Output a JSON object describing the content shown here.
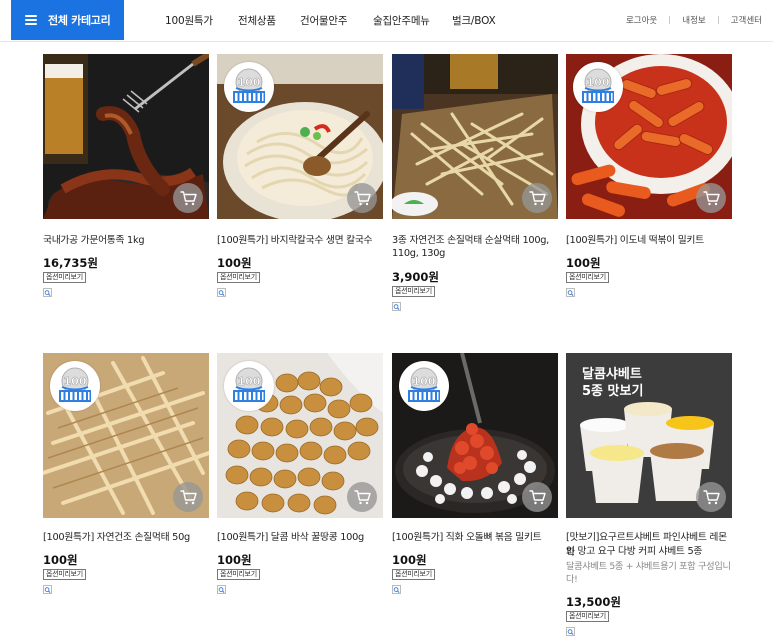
{
  "header": {
    "category_button": "전체 카테고리",
    "nav": [
      "100원특가",
      "전체상품",
      "건어물안주",
      "술집안주메뉴",
      "벌크/BOX"
    ],
    "utility": [
      "로그아웃",
      "내정보",
      "고객센터"
    ]
  },
  "products": [
    {
      "name": "국내가공 가문어통족 1kg",
      "name2": "",
      "desc": "",
      "price": "16,735원",
      "option": "옵션미리보기",
      "badge": false,
      "image": "grilled-squid"
    },
    {
      "name": "[100원특가] 바지락칼국수 생면 칼국수",
      "name2": "",
      "desc": "",
      "price": "100원",
      "option": "옵션미리보기",
      "badge": true,
      "image": "kalguksu"
    },
    {
      "name": "3종 자연건조 손질먹태 순살먹태 100g,",
      "name2": "110g, 130g",
      "desc": "",
      "price": "3,900원",
      "option": "옵션미리보기",
      "badge": false,
      "image": "dried-pollock"
    },
    {
      "name": "[100원특가] 이도네 떡볶이 밀키트",
      "name2": "",
      "desc": "",
      "price": "100원",
      "option": "옵션미리보기",
      "badge": true,
      "image": "tteokbokki"
    },
    {
      "name": "[100원특가] 자연건조 손질먹태 50g",
      "name2": "",
      "desc": "",
      "price": "100원",
      "option": "옵션미리보기",
      "badge": true,
      "image": "dried-pollock-2"
    },
    {
      "name": "[100원특가] 달콤 바삭 꿀땅콩 100g",
      "name2": "",
      "desc": "",
      "price": "100원",
      "option": "옵션미리보기",
      "badge": true,
      "image": "honey-peanuts"
    },
    {
      "name": "[100원특가] 직화 오돌뼈 볶음 밀키트",
      "name2": "",
      "desc": "",
      "price": "100원",
      "option": "옵션미리보기",
      "badge": true,
      "image": "odolppyeo"
    },
    {
      "name": "[맛보기]요구르트샤베트 파인샤베트 레몬 파",
      "name2": "인 망고 요구 다방 커피 샤베트 5종",
      "desc": "달콤샤베트 5종 + 샤베트용기 포함 구성입니",
      "desc2": "다!",
      "price": "13,500원",
      "option": "옵션미리보기",
      "badge": false,
      "image": "sherbet-cups",
      "banner_line1": "달콤샤베트",
      "banner_line2": "5종 맛보기"
    }
  ],
  "colors": {
    "accent": "#1a73e0",
    "cart_button": "#969696"
  },
  "icons": {
    "menu": "hamburger-icon",
    "cart": "cart-icon",
    "zoom": "magnifier-icon",
    "badge": "100-won-badge-icon"
  }
}
